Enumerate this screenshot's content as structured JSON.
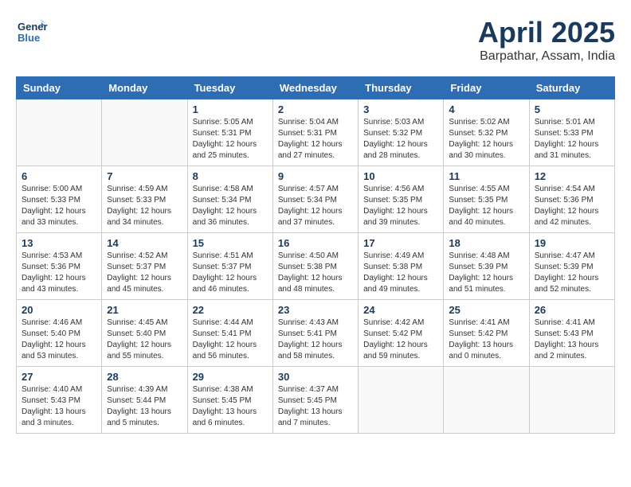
{
  "header": {
    "logo_general": "General",
    "logo_blue": "Blue",
    "month_title": "April 2025",
    "location": "Barpathar, Assam, India"
  },
  "days_of_week": [
    "Sunday",
    "Monday",
    "Tuesday",
    "Wednesday",
    "Thursday",
    "Friday",
    "Saturday"
  ],
  "weeks": [
    [
      {
        "num": "",
        "sunrise": "",
        "sunset": "",
        "daylight": ""
      },
      {
        "num": "",
        "sunrise": "",
        "sunset": "",
        "daylight": ""
      },
      {
        "num": "1",
        "sunrise": "Sunrise: 5:05 AM",
        "sunset": "Sunset: 5:31 PM",
        "daylight": "Daylight: 12 hours and 25 minutes."
      },
      {
        "num": "2",
        "sunrise": "Sunrise: 5:04 AM",
        "sunset": "Sunset: 5:31 PM",
        "daylight": "Daylight: 12 hours and 27 minutes."
      },
      {
        "num": "3",
        "sunrise": "Sunrise: 5:03 AM",
        "sunset": "Sunset: 5:32 PM",
        "daylight": "Daylight: 12 hours and 28 minutes."
      },
      {
        "num": "4",
        "sunrise": "Sunrise: 5:02 AM",
        "sunset": "Sunset: 5:32 PM",
        "daylight": "Daylight: 12 hours and 30 minutes."
      },
      {
        "num": "5",
        "sunrise": "Sunrise: 5:01 AM",
        "sunset": "Sunset: 5:33 PM",
        "daylight": "Daylight: 12 hours and 31 minutes."
      }
    ],
    [
      {
        "num": "6",
        "sunrise": "Sunrise: 5:00 AM",
        "sunset": "Sunset: 5:33 PM",
        "daylight": "Daylight: 12 hours and 33 minutes."
      },
      {
        "num": "7",
        "sunrise": "Sunrise: 4:59 AM",
        "sunset": "Sunset: 5:33 PM",
        "daylight": "Daylight: 12 hours and 34 minutes."
      },
      {
        "num": "8",
        "sunrise": "Sunrise: 4:58 AM",
        "sunset": "Sunset: 5:34 PM",
        "daylight": "Daylight: 12 hours and 36 minutes."
      },
      {
        "num": "9",
        "sunrise": "Sunrise: 4:57 AM",
        "sunset": "Sunset: 5:34 PM",
        "daylight": "Daylight: 12 hours and 37 minutes."
      },
      {
        "num": "10",
        "sunrise": "Sunrise: 4:56 AM",
        "sunset": "Sunset: 5:35 PM",
        "daylight": "Daylight: 12 hours and 39 minutes."
      },
      {
        "num": "11",
        "sunrise": "Sunrise: 4:55 AM",
        "sunset": "Sunset: 5:35 PM",
        "daylight": "Daylight: 12 hours and 40 minutes."
      },
      {
        "num": "12",
        "sunrise": "Sunrise: 4:54 AM",
        "sunset": "Sunset: 5:36 PM",
        "daylight": "Daylight: 12 hours and 42 minutes."
      }
    ],
    [
      {
        "num": "13",
        "sunrise": "Sunrise: 4:53 AM",
        "sunset": "Sunset: 5:36 PM",
        "daylight": "Daylight: 12 hours and 43 minutes."
      },
      {
        "num": "14",
        "sunrise": "Sunrise: 4:52 AM",
        "sunset": "Sunset: 5:37 PM",
        "daylight": "Daylight: 12 hours and 45 minutes."
      },
      {
        "num": "15",
        "sunrise": "Sunrise: 4:51 AM",
        "sunset": "Sunset: 5:37 PM",
        "daylight": "Daylight: 12 hours and 46 minutes."
      },
      {
        "num": "16",
        "sunrise": "Sunrise: 4:50 AM",
        "sunset": "Sunset: 5:38 PM",
        "daylight": "Daylight: 12 hours and 48 minutes."
      },
      {
        "num": "17",
        "sunrise": "Sunrise: 4:49 AM",
        "sunset": "Sunset: 5:38 PM",
        "daylight": "Daylight: 12 hours and 49 minutes."
      },
      {
        "num": "18",
        "sunrise": "Sunrise: 4:48 AM",
        "sunset": "Sunset: 5:39 PM",
        "daylight": "Daylight: 12 hours and 51 minutes."
      },
      {
        "num": "19",
        "sunrise": "Sunrise: 4:47 AM",
        "sunset": "Sunset: 5:39 PM",
        "daylight": "Daylight: 12 hours and 52 minutes."
      }
    ],
    [
      {
        "num": "20",
        "sunrise": "Sunrise: 4:46 AM",
        "sunset": "Sunset: 5:40 PM",
        "daylight": "Daylight: 12 hours and 53 minutes."
      },
      {
        "num": "21",
        "sunrise": "Sunrise: 4:45 AM",
        "sunset": "Sunset: 5:40 PM",
        "daylight": "Daylight: 12 hours and 55 minutes."
      },
      {
        "num": "22",
        "sunrise": "Sunrise: 4:44 AM",
        "sunset": "Sunset: 5:41 PM",
        "daylight": "Daylight: 12 hours and 56 minutes."
      },
      {
        "num": "23",
        "sunrise": "Sunrise: 4:43 AM",
        "sunset": "Sunset: 5:41 PM",
        "daylight": "Daylight: 12 hours and 58 minutes."
      },
      {
        "num": "24",
        "sunrise": "Sunrise: 4:42 AM",
        "sunset": "Sunset: 5:42 PM",
        "daylight": "Daylight: 12 hours and 59 minutes."
      },
      {
        "num": "25",
        "sunrise": "Sunrise: 4:41 AM",
        "sunset": "Sunset: 5:42 PM",
        "daylight": "Daylight: 13 hours and 0 minutes."
      },
      {
        "num": "26",
        "sunrise": "Sunrise: 4:41 AM",
        "sunset": "Sunset: 5:43 PM",
        "daylight": "Daylight: 13 hours and 2 minutes."
      }
    ],
    [
      {
        "num": "27",
        "sunrise": "Sunrise: 4:40 AM",
        "sunset": "Sunset: 5:43 PM",
        "daylight": "Daylight: 13 hours and 3 minutes."
      },
      {
        "num": "28",
        "sunrise": "Sunrise: 4:39 AM",
        "sunset": "Sunset: 5:44 PM",
        "daylight": "Daylight: 13 hours and 5 minutes."
      },
      {
        "num": "29",
        "sunrise": "Sunrise: 4:38 AM",
        "sunset": "Sunset: 5:45 PM",
        "daylight": "Daylight: 13 hours and 6 minutes."
      },
      {
        "num": "30",
        "sunrise": "Sunrise: 4:37 AM",
        "sunset": "Sunset: 5:45 PM",
        "daylight": "Daylight: 13 hours and 7 minutes."
      },
      {
        "num": "",
        "sunrise": "",
        "sunset": "",
        "daylight": ""
      },
      {
        "num": "",
        "sunrise": "",
        "sunset": "",
        "daylight": ""
      },
      {
        "num": "",
        "sunrise": "",
        "sunset": "",
        "daylight": ""
      }
    ]
  ]
}
